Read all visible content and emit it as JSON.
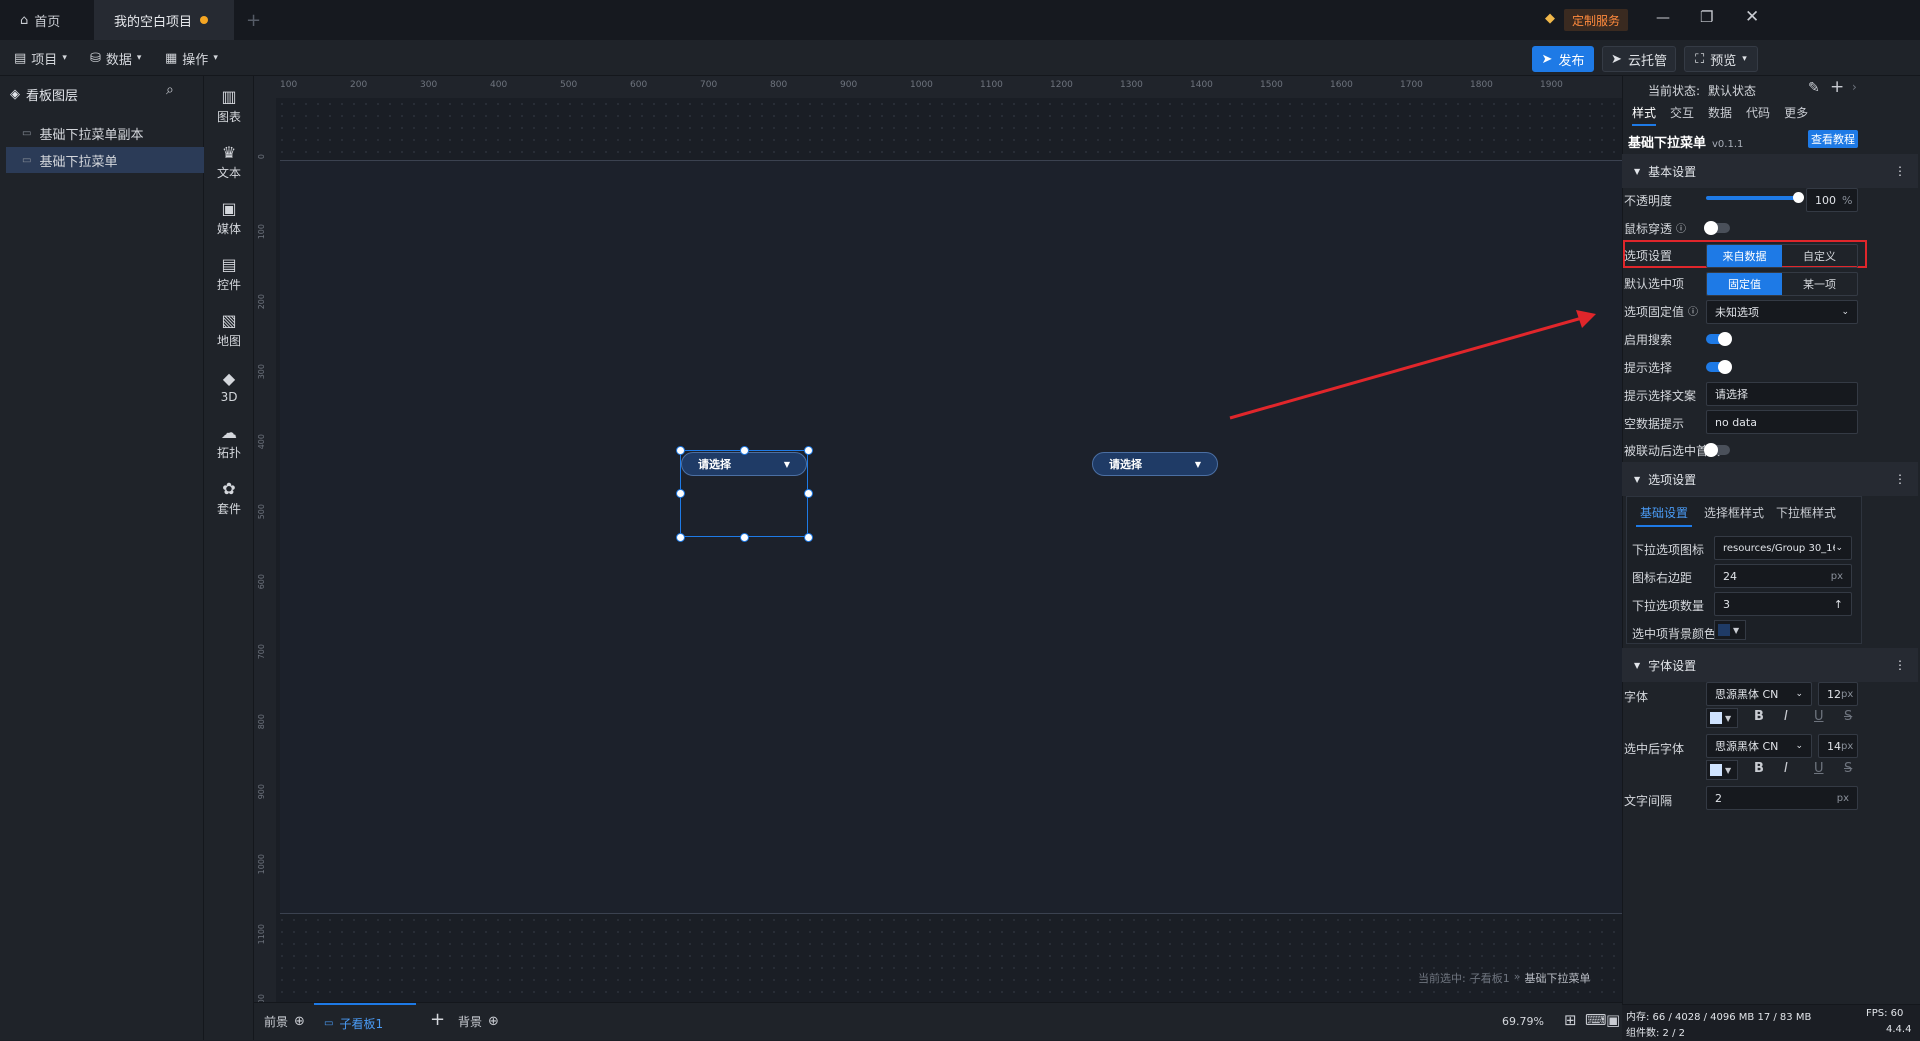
{
  "tabs": {
    "home": "首页",
    "project": "我的空白项目"
  },
  "window": {
    "service_badge": "定制服务"
  },
  "toolbar": {
    "project": "项目",
    "data": "数据",
    "ops": "操作",
    "publish": "发布",
    "cloud": "云托管",
    "preview": "预览"
  },
  "layers": {
    "title": "看板图层",
    "items": [
      "基础下拉菜单副本",
      "基础下拉菜单"
    ]
  },
  "components": [
    "图表",
    "文本",
    "媒体",
    "控件",
    "地图",
    "3D",
    "拓扑",
    "套件"
  ],
  "ruler": {
    "top_ticks": [
      "100",
      "200",
      "300",
      "400",
      "500",
      "600",
      "700",
      "800",
      "900",
      "1000",
      "1100",
      "1200",
      "1300",
      "1400",
      "1500",
      "1600",
      "1700",
      "1800",
      "1900"
    ],
    "left_ticks": [
      "0",
      "100",
      "200",
      "300",
      "400",
      "500",
      "600",
      "700",
      "800",
      "900",
      "1000",
      "1100",
      "00"
    ]
  },
  "canvas": {
    "dropdown_text": "请选择",
    "status_prefix": "当前选中:",
    "status_path": "子看板1",
    "status_sep": "»",
    "status_name": "基础下拉菜单"
  },
  "bottombar": {
    "foreground": "前景",
    "board": "子看板1",
    "background": "背景",
    "zoom": "69.79%"
  },
  "panel": {
    "state_label": "当前状态:",
    "state_value": "默认状态",
    "tabs": [
      "样式",
      "交互",
      "数据",
      "代码",
      "更多"
    ],
    "component_name": "基础下拉菜单",
    "component_version": "v0.1.1",
    "tutorial": "查看教程",
    "basic": {
      "title": "基本设置",
      "opacity_label": "不透明度",
      "opacity_value": "100",
      "opacity_unit": "%",
      "opacity_level": 1.0,
      "mouse_label": "鼠标穿透",
      "option_label": "选项设置",
      "option_a": "来自数据",
      "option_b": "自定义",
      "default_label": "默认选中项",
      "default_a": "固定值",
      "default_b": "某一项",
      "fixed_label": "选项固定值",
      "fixed_value": "未知选项",
      "search_label": "启用搜索",
      "hint_label": "提示选择",
      "hint_text_label": "提示选择文案",
      "hint_text_value": "请选择",
      "empty_label": "空数据提示",
      "empty_value": "no data",
      "linked_label": "被联动后选中首项"
    },
    "options": {
      "title": "选项设置",
      "subtabs": [
        "基础设置",
        "选择框样式",
        "下拉框样式"
      ],
      "icon_label": "下拉选项图标",
      "icon_value": "resources/Group 30_1698...",
      "margin_label": "图标右边距",
      "margin_value": "24",
      "count_label": "下拉选项数量",
      "count_value": "3",
      "bg_label": "选中项背景颜色",
      "unit": "px"
    },
    "font": {
      "title": "字体设置",
      "font_label": "字体",
      "font_value": "思源黑体 CN",
      "font_size": "12",
      "selected_label": "选中后字体",
      "selected_value": "思源黑体 CN",
      "selected_size": "14",
      "spacing_label": "文字间隔",
      "spacing_value": "2",
      "unit": "px"
    },
    "stats": {
      "memory": "内存: 66 / 4028 / 4096 MB 17 / 83 MB",
      "fps": "FPS: 60",
      "count": "组件数: 2 / 2",
      "version": "4.4.4"
    }
  },
  "colors": {
    "accent": "#1e7ae6",
    "highlight": "#e0262b",
    "bg": "#1b1f26"
  }
}
